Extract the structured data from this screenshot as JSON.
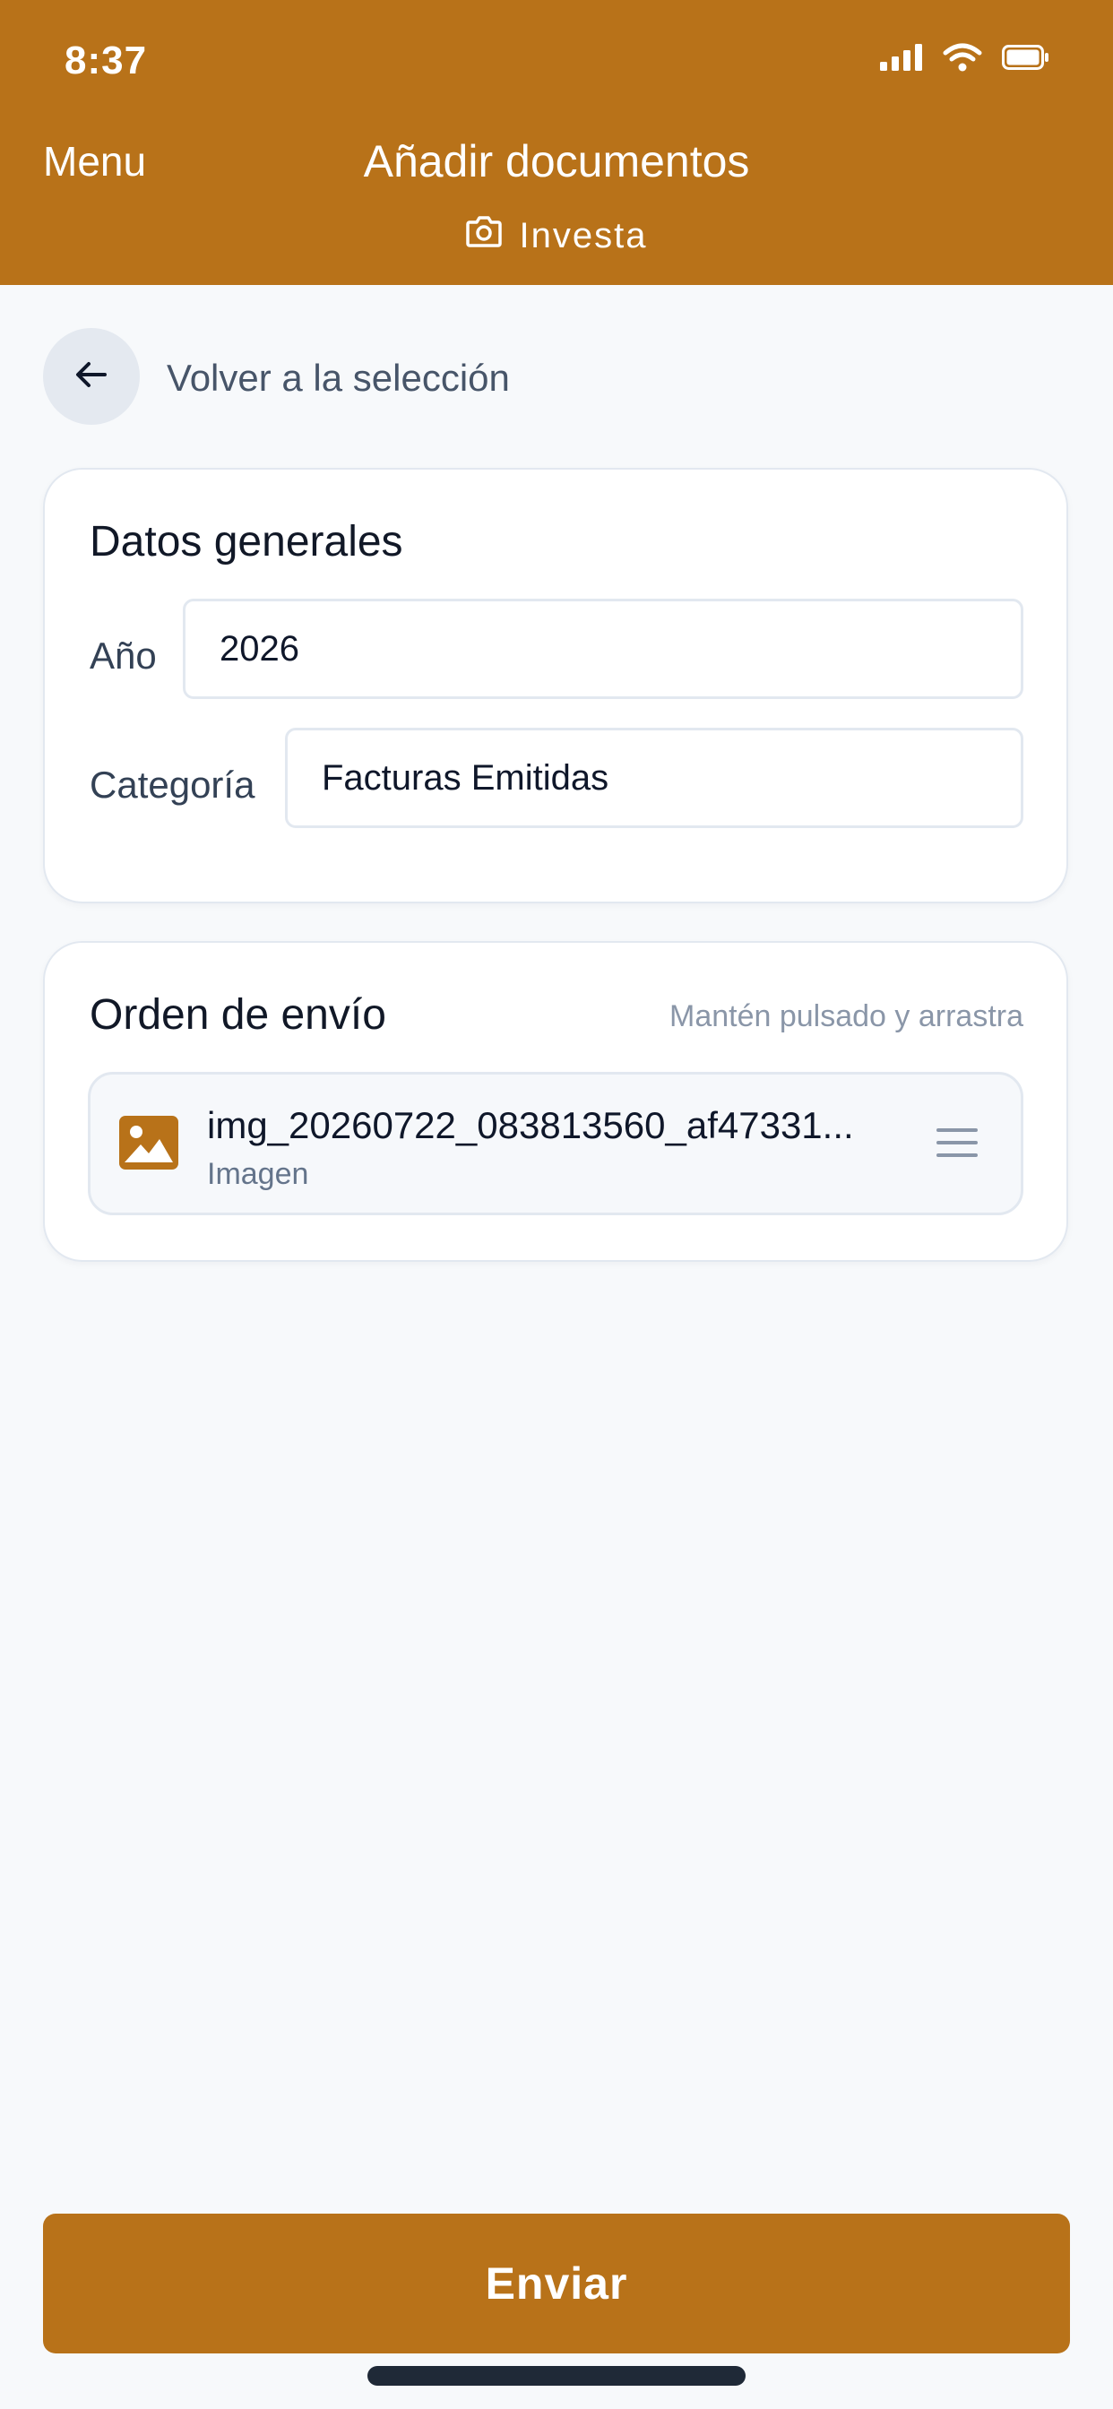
{
  "status_bar": {
    "time": "8:37",
    "icons": [
      "cellular-signal-icon",
      "wifi-icon",
      "battery-icon"
    ]
  },
  "header": {
    "menu_label": "Menu",
    "title": "Añadir documentos",
    "subtitle": "Investa",
    "subtitle_icon": "camera-icon"
  },
  "navigation": {
    "back_label": "Volver a la selección",
    "back_icon": "arrow-left-icon"
  },
  "general_data": {
    "title": "Datos generales",
    "year_label": "Año",
    "year_value": "2026",
    "category_label": "Categoría",
    "category_value": "Facturas Emitidas"
  },
  "send_order": {
    "title": "Orden de envío",
    "hint": "Mantén pulsado y arrastra",
    "items": [
      {
        "name": "img_20260722_083813560_af47331...",
        "type": "Imagen",
        "icon": "image-icon"
      }
    ]
  },
  "actions": {
    "send_label": "Enviar"
  },
  "colors": {
    "brand": "#b87219",
    "background": "#f7f9fb",
    "card": "#ffffff",
    "muted_text": "#64748b"
  }
}
